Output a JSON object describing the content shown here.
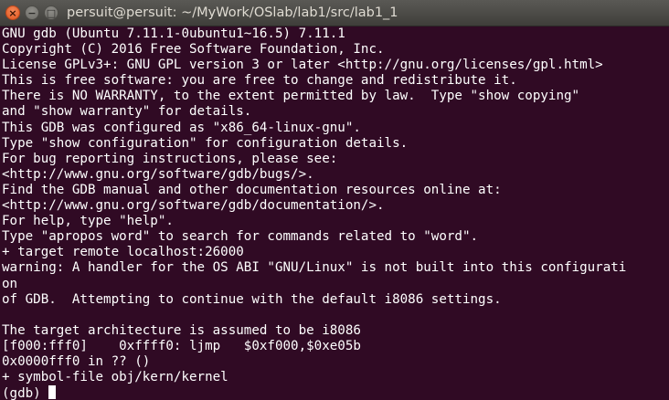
{
  "window": {
    "title": "persuit@persuit: ~/MyWork/OSlab/lab1/src/lab1_1",
    "close_glyph": "×",
    "minimize_glyph": "−",
    "maximize_glyph": "□"
  },
  "terminal": {
    "lines": [
      "GNU gdb (Ubuntu 7.11.1-0ubuntu1~16.5) 7.11.1",
      "Copyright (C) 2016 Free Software Foundation, Inc.",
      "License GPLv3+: GNU GPL version 3 or later <http://gnu.org/licenses/gpl.html>",
      "This is free software: you are free to change and redistribute it.",
      "There is NO WARRANTY, to the extent permitted by law.  Type \"show copying\"",
      "and \"show warranty\" for details.",
      "This GDB was configured as \"x86_64-linux-gnu\".",
      "Type \"show configuration\" for configuration details.",
      "For bug reporting instructions, please see:",
      "<http://www.gnu.org/software/gdb/bugs/>.",
      "Find the GDB manual and other documentation resources online at:",
      "<http://www.gnu.org/software/gdb/documentation/>.",
      "For help, type \"help\".",
      "Type \"apropos word\" to search for commands related to \"word\".",
      "+ target remote localhost:26000",
      "warning: A handler for the OS ABI \"GNU/Linux\" is not built into this configurati",
      "on",
      "of GDB.  Attempting to continue with the default i8086 settings.",
      "",
      "The target architecture is assumed to be i8086",
      "[f000:fff0]    0xffff0: ljmp   $0xf000,$0xe05b",
      "0x0000fff0 in ?? ()",
      "+ symbol-file obj/kern/kernel"
    ],
    "prompt": "(gdb) "
  },
  "colors": {
    "terminal_background": "#300a24",
    "terminal_text": "#ffffff",
    "titlebar": "#3f3e3a",
    "close_button": "#e0541c"
  }
}
